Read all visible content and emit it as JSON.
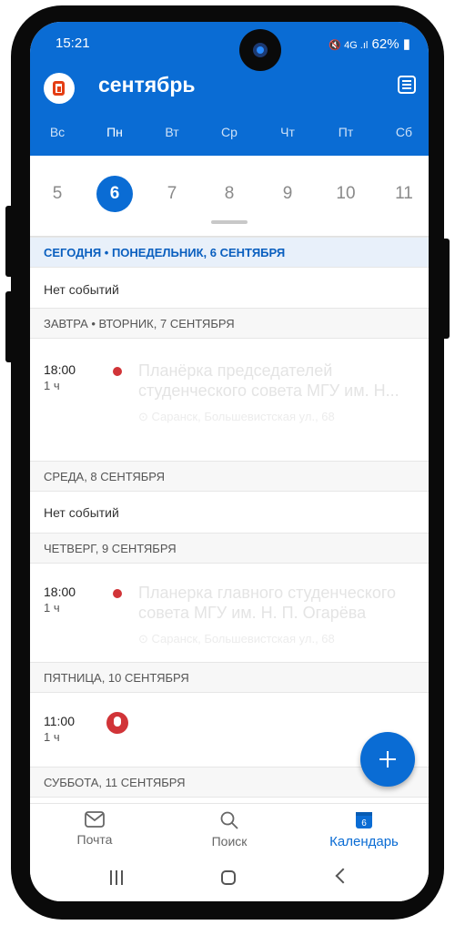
{
  "status": {
    "time": "15:21",
    "battery": "62%",
    "icons_right": "🔇 4G .ıl"
  },
  "header": {
    "month": "сентябрь"
  },
  "weekdays": [
    "Вс",
    "Пн",
    "Вт",
    "Ср",
    "Чт",
    "Пт",
    "Сб"
  ],
  "dates": [
    "5",
    "6",
    "7",
    "8",
    "9",
    "10",
    "11"
  ],
  "selected_date": "6",
  "agenda": {
    "today_header": "СЕГОДНЯ • ПОНЕДЕЛЬНИК, 6 СЕНТЯБРЯ",
    "no_events": "Нет событий",
    "tue_header": "ЗАВТРА • ВТОРНИК, 7 СЕНТЯБРЯ",
    "ev1": {
      "time": "18:00",
      "duration": "1 ч",
      "title": "Планёрка председателей студенческого совета МГУ им. Н...",
      "location": "Саранск, Большевистская ул., 68"
    },
    "wed_header": "СРЕДА, 8 СЕНТЯБРЯ",
    "thu_header": "ЧЕТВЕРГ, 9 СЕНТЯБРЯ",
    "ev2": {
      "time": "18:00",
      "duration": "1 ч",
      "title": "Планерка главного студенческого совета МГУ им. Н. П. Огарёва",
      "location": "Саранск, Большевистская ул., 68"
    },
    "fri_header": "ПЯТНИЦА, 10 СЕНТЯБРЯ",
    "ev3": {
      "time": "11:00",
      "duration": "1 ч"
    },
    "sat_header": "СУББОТА, 11 СЕНТЯБРЯ"
  },
  "tabs": {
    "mail": "Почта",
    "search": "Поиск",
    "calendar": "Календарь",
    "calendar_badge": "6"
  },
  "colors": {
    "accent": "#0a6cd4",
    "event_dot": "#d13438"
  }
}
